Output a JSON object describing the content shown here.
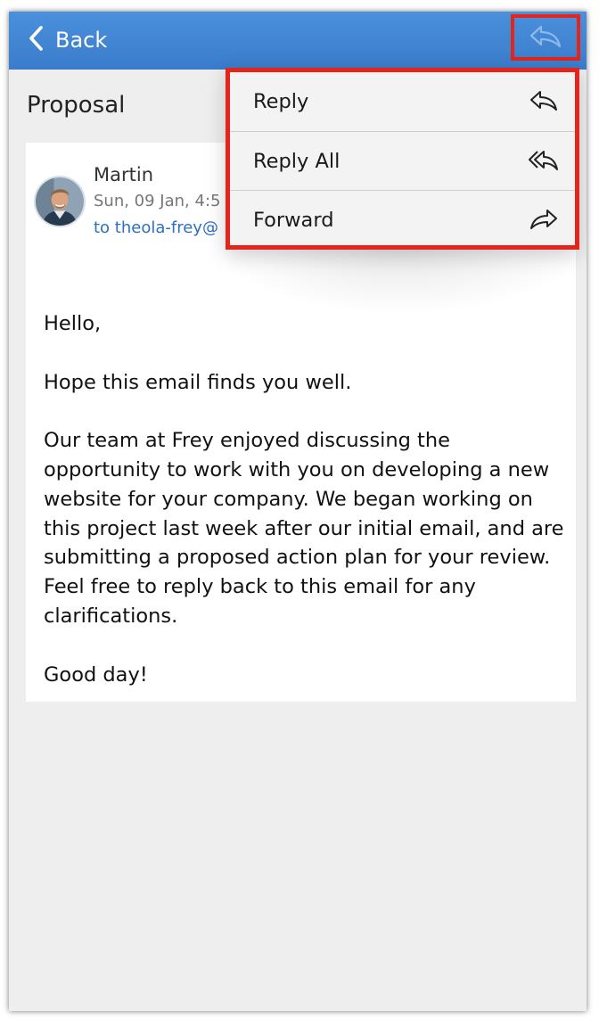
{
  "header": {
    "back_label": "Back",
    "bar_color": "#3a7ccb",
    "highlight_color": "#e5241b"
  },
  "email": {
    "subject": "Proposal",
    "sender": "Martin",
    "date": "Sun, 09 Jan, 4:5",
    "to": "to theola-frey@",
    "body": [
      "Hello,",
      "Hope this email finds you well.",
      "Our team at Frey enjoyed discussing the opportunity to work with you on developing a new website for your company. We began working on this project last week after our initial email, and are submitting a proposed action plan for your review.  Feel free to reply back to this email for any clarifications.",
      "Good day!"
    ]
  },
  "menu": {
    "items": [
      {
        "label": "Reply",
        "icon": "reply-icon"
      },
      {
        "label": "Reply All",
        "icon": "reply-all-icon"
      },
      {
        "label": "Forward",
        "icon": "forward-icon"
      }
    ]
  },
  "icons": {
    "back": "chevron-left-icon",
    "top_action": "reply-icon"
  }
}
